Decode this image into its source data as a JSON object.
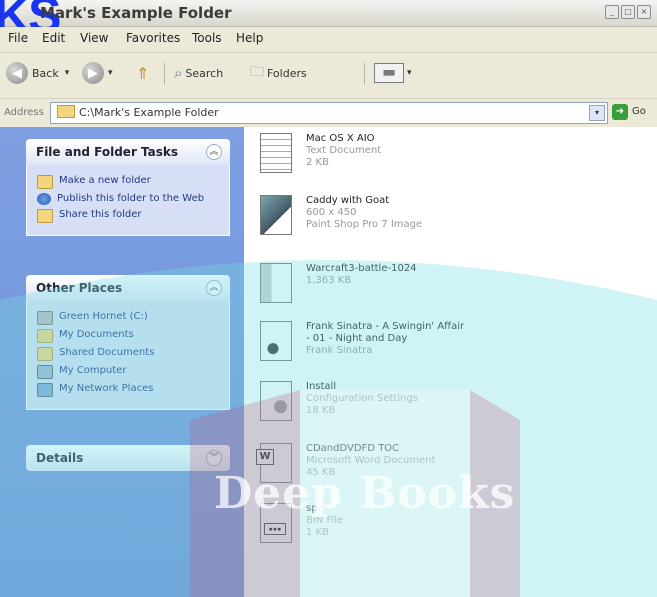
{
  "window": {
    "title": "Mark's Example Folder",
    "controls": [
      "_",
      "□",
      "×"
    ]
  },
  "watermark": {
    "corner_text": "KS",
    "center_text": "Deep Books"
  },
  "menu": [
    "File",
    "Edit",
    "View",
    "Favorites",
    "Tools",
    "Help"
  ],
  "toolbar": {
    "back": "Back",
    "search": "Search",
    "folders": "Folders"
  },
  "address": {
    "label": "Address",
    "value": "C:\\Mark's Example Folder",
    "go": "Go"
  },
  "sidebar": {
    "file_tasks": {
      "title": "File and Folder Tasks",
      "items": [
        "Make a new folder",
        "Publish this folder to the Web",
        "Share this folder"
      ]
    },
    "other_places": {
      "title": "Other Places",
      "items": [
        "Green Hornet (C:)",
        "My Documents",
        "Shared Documents",
        "My Computer",
        "My Network Places"
      ]
    },
    "details": {
      "title": "Details"
    }
  },
  "files": [
    {
      "name": "Mac OS X AIO",
      "meta1": "Text Document",
      "meta2": "2 KB"
    },
    {
      "name": "Caddy with Goat",
      "meta1": "600 x 450",
      "meta2": "Paint Shop Pro 7 Image"
    },
    {
      "name": "Warcraft3-battle-1024",
      "meta1": "1,363 KB",
      "meta2": ""
    },
    {
      "name": "Frank Sinatra - A Swingin' Affair",
      "name2": "- 01 - Night and Day",
      "meta1": "Frank Sinatra"
    },
    {
      "name": "Install",
      "meta1": "Configuration Settings",
      "meta2": "18 KB"
    },
    {
      "name": "CDandDVDFD TOC",
      "meta1": "Microsoft Word Document",
      "meta2": "45 KB"
    },
    {
      "name": "sp",
      "meta1": "BIN File",
      "meta2": "1 KB"
    }
  ],
  "colors": {
    "task_pane": "#7ea0e2",
    "panel_body": "#d6dff5",
    "link": "#223a80"
  }
}
